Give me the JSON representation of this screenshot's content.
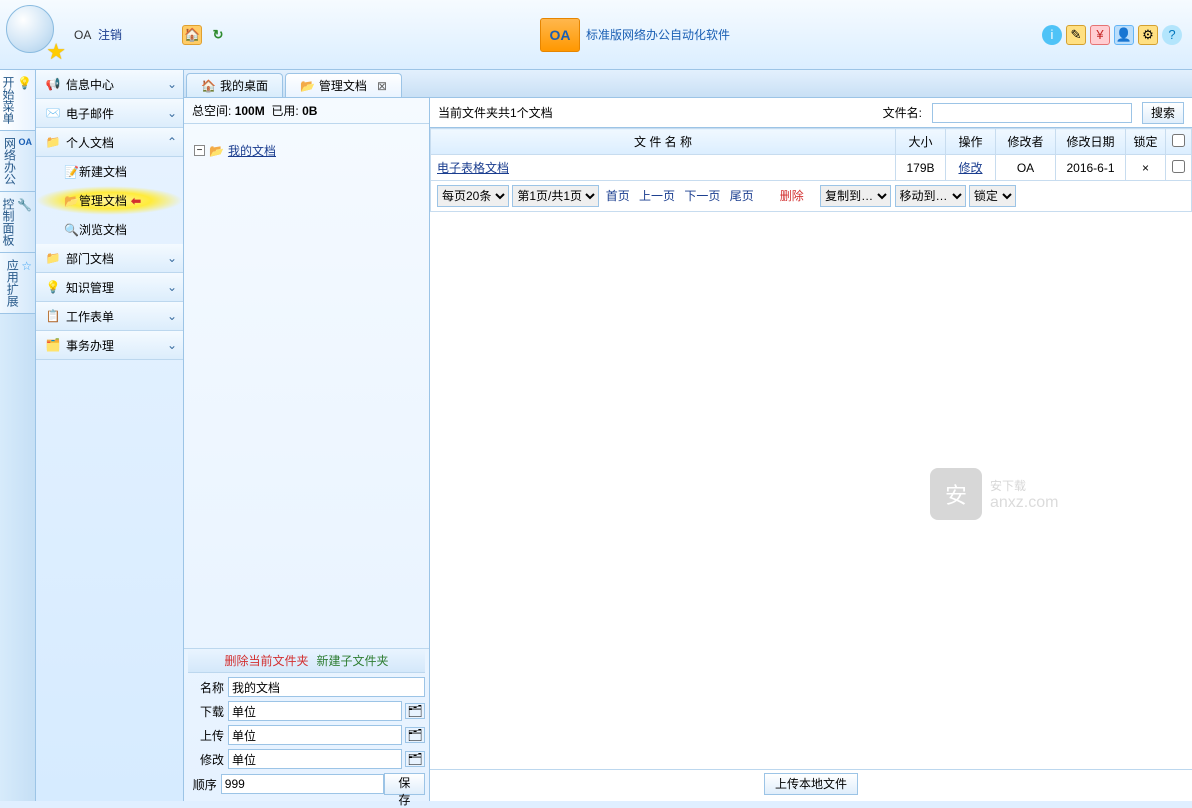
{
  "top": {
    "user": "OA",
    "logout": "注销",
    "title": "标准版网络办公自动化软件",
    "oa_badge": "OA"
  },
  "vtabs": [
    {
      "label": "开始菜单",
      "icon": "💡"
    },
    {
      "label": "网络办公",
      "icon": "OA"
    },
    {
      "label": "控制面板",
      "icon": "🔧"
    },
    {
      "label": "应用扩展",
      "icon": "☆"
    }
  ],
  "nav": [
    {
      "label": "信息中心",
      "icon": "📢",
      "expand": "⌄"
    },
    {
      "label": "电子邮件",
      "icon": "✉️",
      "expand": "⌄"
    },
    {
      "label": "个人文档",
      "icon": "📁",
      "expand": "⌃",
      "children": [
        {
          "label": "新建文档",
          "icon": "📝"
        },
        {
          "label": "管理文档",
          "icon": "📂",
          "active": true,
          "arrow": "⬅"
        },
        {
          "label": "浏览文档",
          "icon": "🔍"
        }
      ]
    },
    {
      "label": "部门文档",
      "icon": "📁",
      "expand": "⌄"
    },
    {
      "label": "知识管理",
      "icon": "💡",
      "expand": "⌄"
    },
    {
      "label": "工作表单",
      "icon": "📋",
      "expand": "⌄"
    },
    {
      "label": "事务办理",
      "icon": "🗂️",
      "expand": "⌄"
    }
  ],
  "tabs": [
    {
      "label": "我的桌面",
      "icon": "🏠"
    },
    {
      "label": "管理文档",
      "icon": "📂",
      "active": true,
      "closable": true
    }
  ],
  "space": {
    "total_label": "总空间:",
    "total": "100M",
    "used_label": "已用:",
    "used": "0B"
  },
  "tree": {
    "root": "我的文档"
  },
  "folder_form": {
    "delete": "删除当前文件夹",
    "create": "新建子文件夹",
    "name_label": "名称",
    "name_value": "我的文档",
    "download_label": "下载",
    "download_value": "单位",
    "upload_label": "上传",
    "upload_value": "单位",
    "modify_label": "修改",
    "modify_value": "单位",
    "order_label": "顺序",
    "order_value": "999",
    "save": "保存"
  },
  "rp": {
    "summary": "当前文件夹共1个文档",
    "filename_label": "文件名:",
    "search": "搜索"
  },
  "grid": {
    "headers": {
      "name": "文 件 名 称",
      "size": "大小",
      "op": "操作",
      "editor": "修改者",
      "date": "修改日期",
      "lock": "锁定"
    },
    "rows": [
      {
        "name": "电子表格文档",
        "size": "179B",
        "op": "修改",
        "editor": "OA",
        "date": "2016-6-1",
        "lock": "×"
      }
    ]
  },
  "pager": {
    "page_size": "每页20条",
    "page_info": "第1页/共1页",
    "first": "首页",
    "prev": "上一页",
    "next": "下一页",
    "last": "尾页",
    "delete": "删除",
    "copy_to": "复制到…",
    "move_to": "移动到…",
    "lock": "锁定"
  },
  "upload_local": "上传本地文件",
  "watermark": {
    "main": "安下载",
    "sub": "anxz.com",
    "badge": "安"
  }
}
